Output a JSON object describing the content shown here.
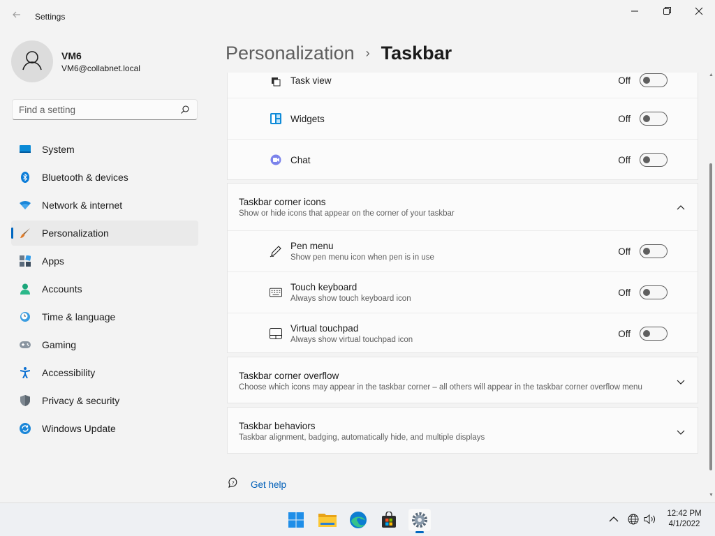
{
  "window": {
    "title": "Settings"
  },
  "profile": {
    "name": "VM6",
    "email": "VM6@collabnet.local"
  },
  "search": {
    "placeholder": "Find a setting",
    "value": ""
  },
  "nav": {
    "items": [
      {
        "label": "System",
        "icon": "system-icon"
      },
      {
        "label": "Bluetooth & devices",
        "icon": "bluetooth-icon"
      },
      {
        "label": "Network & internet",
        "icon": "wifi-icon"
      },
      {
        "label": "Personalization",
        "icon": "brush-icon",
        "selected": true
      },
      {
        "label": "Apps",
        "icon": "apps-icon"
      },
      {
        "label": "Accounts",
        "icon": "accounts-icon"
      },
      {
        "label": "Time & language",
        "icon": "time-language-icon"
      },
      {
        "label": "Gaming",
        "icon": "gamepad-icon"
      },
      {
        "label": "Accessibility",
        "icon": "accessibility-icon"
      },
      {
        "label": "Privacy & security",
        "icon": "shield-icon"
      },
      {
        "label": "Windows Update",
        "icon": "windows-update-icon"
      }
    ]
  },
  "header": {
    "parent": "Personalization",
    "separator": "›",
    "current": "Taskbar"
  },
  "taskbar_items": {
    "rows": [
      {
        "title": "Task view",
        "state": "Off",
        "icon": "task-view-icon",
        "on": false
      },
      {
        "title": "Widgets",
        "state": "Off",
        "icon": "widgets-icon",
        "on": false
      },
      {
        "title": "Chat",
        "state": "Off",
        "icon": "chat-icon",
        "on": false
      }
    ]
  },
  "corner_icons": {
    "title": "Taskbar corner icons",
    "description": "Show or hide icons that appear on the corner of your taskbar",
    "expanded": true,
    "rows": [
      {
        "title": "Pen menu",
        "description": "Show pen menu icon when pen is in use",
        "state": "Off",
        "icon": "pen-icon",
        "on": false
      },
      {
        "title": "Touch keyboard",
        "description": "Always show touch keyboard icon",
        "state": "Off",
        "icon": "keyboard-icon",
        "on": false
      },
      {
        "title": "Virtual touchpad",
        "description": "Always show virtual touchpad icon",
        "state": "Off",
        "icon": "touchpad-icon",
        "on": false
      }
    ]
  },
  "corner_overflow": {
    "title": "Taskbar corner overflow",
    "description": "Choose which icons may appear in the taskbar corner – all others will appear in the taskbar corner overflow menu"
  },
  "behaviors": {
    "title": "Taskbar behaviors",
    "description": "Taskbar alignment, badging, automatically hide, and multiple displays"
  },
  "help": {
    "label": "Get help"
  },
  "system_taskbar": {
    "apps": [
      "start-icon",
      "file-explorer-icon",
      "edge-icon",
      "store-icon",
      "settings-icon"
    ],
    "active_app": "settings-icon",
    "tray": [
      "chevron-up-icon",
      "network-globe-icon",
      "speaker-icon"
    ],
    "time": "12:42 PM",
    "date": "4/1/2022"
  },
  "colors": {
    "accent": "#0067c0",
    "window_bg": "#f3f3f3",
    "card_bg": "#fbfbfb",
    "link": "#005fb8"
  }
}
